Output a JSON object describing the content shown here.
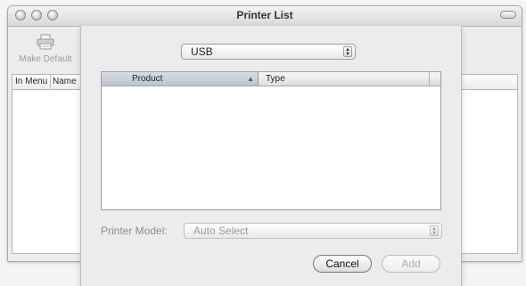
{
  "window": {
    "title": "Printer List"
  },
  "toolbar": {
    "make_default_label": "Make Default"
  },
  "printer_list": {
    "columns": [
      "In Menu",
      "Name"
    ]
  },
  "sheet": {
    "connection": {
      "selected": "USB"
    },
    "table": {
      "columns": [
        "Product",
        "Type"
      ],
      "sorted_column": "Product",
      "rows": []
    },
    "printer_model": {
      "label": "Printer Model:",
      "selected": "Auto Select"
    },
    "buttons": {
      "cancel": "Cancel",
      "add": "Add"
    }
  },
  "icons": {
    "toolbar": "printer-icon",
    "popup": "popup-arrows-icon",
    "sort": "sort-ascending-icon"
  }
}
